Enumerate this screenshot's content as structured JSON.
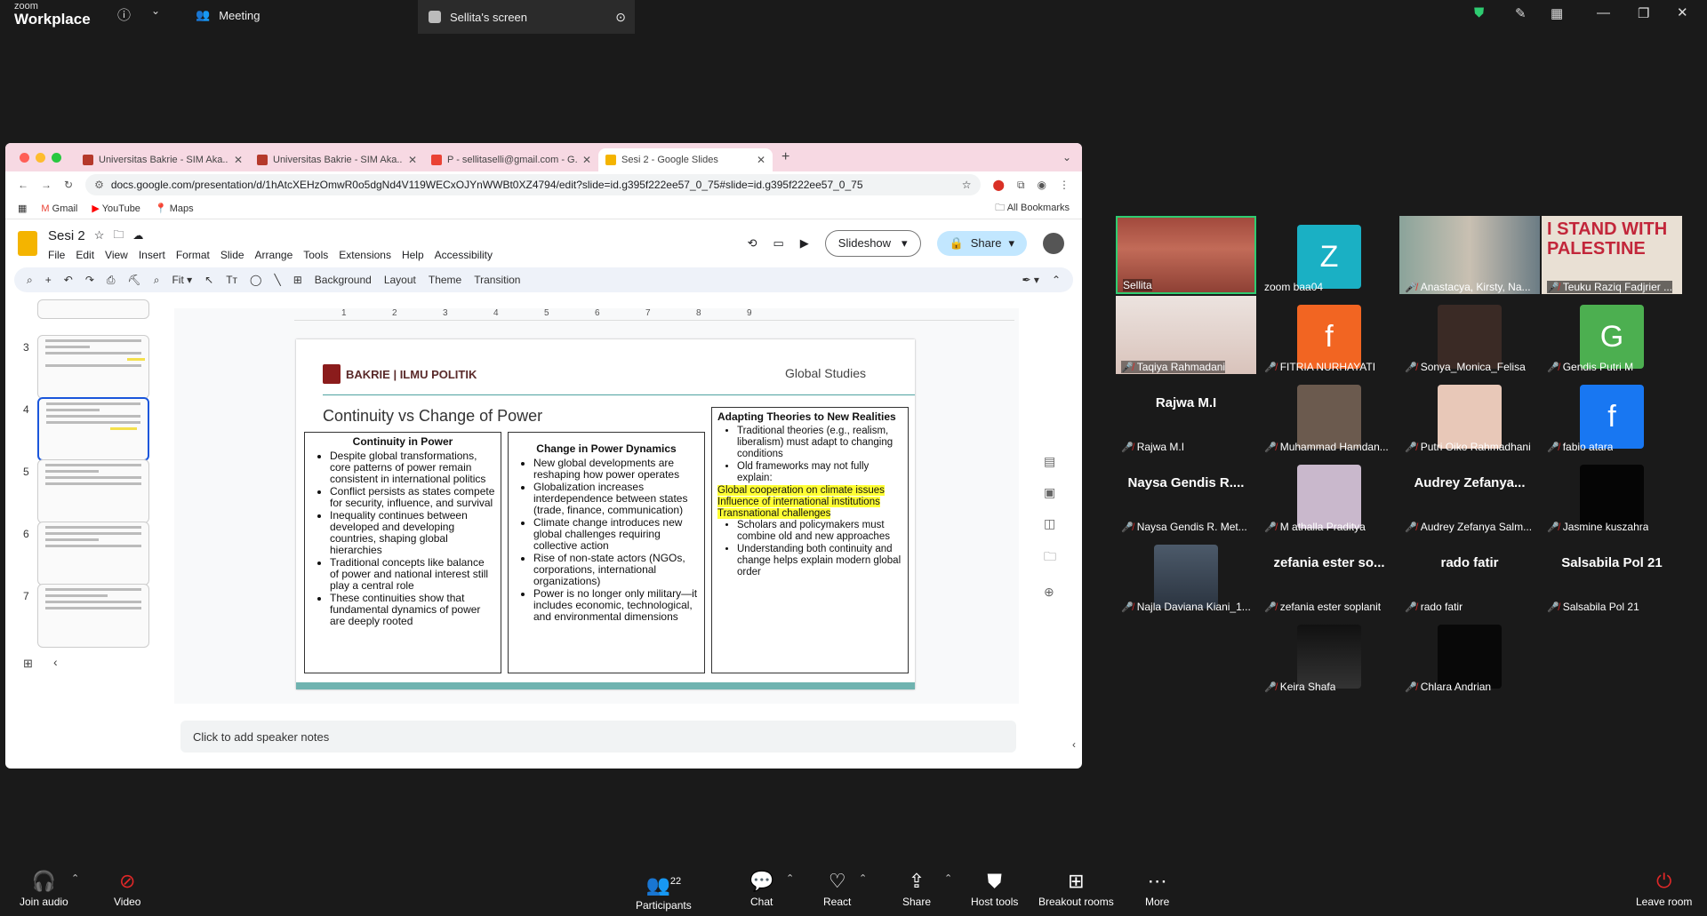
{
  "app": {
    "logo_top": "zoom",
    "logo_bottom": "Workplace"
  },
  "topbar": {
    "meeting_tab": "Meeting",
    "screen_tab": "Sellita's screen"
  },
  "browser": {
    "tabs": [
      {
        "label": "Universitas Bakrie - SIM Aka..."
      },
      {
        "label": "Universitas Bakrie - SIM Aka..."
      },
      {
        "label": "P - sellitaselli@gmail.com - G..."
      },
      {
        "label": "Sesi 2 - Google Slides"
      }
    ],
    "url": "docs.google.com/presentation/d/1hAtcXEHzOmwR0o5dgNd4V119WECxOJYnWWBt0XZ4794/edit?slide=id.g395f222ee57_0_75#slide=id.g395f222ee57_0_75",
    "bookmarks": [
      "Gmail",
      "YouTube",
      "Maps"
    ],
    "all_bookmarks": "All Bookmarks"
  },
  "slides": {
    "doc_title": "Sesi 2",
    "menus": [
      "File",
      "Edit",
      "View",
      "Insert",
      "Format",
      "Slide",
      "Arrange",
      "Tools",
      "Extensions",
      "Help",
      "Accessibility"
    ],
    "slideshow": "Slideshow",
    "share": "Share",
    "zoom": "Fit",
    "toolbar_labels": [
      "Background",
      "Layout",
      "Theme",
      "Transition"
    ],
    "thumb_numbers": [
      "3",
      "4",
      "5",
      "6",
      "7"
    ],
    "ruler_marks": [
      "1",
      "2",
      "3",
      "4",
      "5",
      "6",
      "7",
      "8",
      "9"
    ],
    "notes_placeholder": "Click to add speaker notes"
  },
  "slide": {
    "logo_text": "BAKRIE | ILMU POLITIK",
    "header_right": "Global Studies",
    "title": "Continuity vs Change of Power",
    "col1": {
      "heading": "Continuity in Power",
      "items": [
        "Despite global transformations, core patterns of power remain consistent in international politics",
        "Conflict persists as states compete for security, influence, and survival",
        "Inequality continues between developed and developing countries, shaping global hierarchies",
        "Traditional concepts like balance of power and national interest still play a central role",
        "These continuities show that fundamental dynamics of power are deeply rooted"
      ]
    },
    "col2": {
      "heading": "Change in Power Dynamics",
      "items": [
        "New global developments are reshaping how power operates",
        "Globalization increases interdependence between states (trade, finance, communication)",
        "Climate change introduces new global challenges requiring collective action",
        "Rise of non-state actors (NGOs, corporations, international organizations)",
        "Power is no longer only military—it includes economic, technological, and environmental dimensions"
      ]
    },
    "col3": {
      "heading": "Adapting Theories to New Realities",
      "items_a": [
        "Traditional theories (e.g., realism, liberalism) must adapt to changing conditions",
        "Old frameworks may not fully explain:"
      ],
      "highlights": [
        "Global cooperation on climate issues",
        "Influence of international institutions",
        "Transnational challenges"
      ],
      "items_b": [
        "Scholars and policymakers must combine old and new approaches",
        "Understanding both continuity and change helps explain modern global order"
      ]
    }
  },
  "gallery": {
    "tiles": [
      {
        "name": "Sellita",
        "avatar": "",
        "big": ""
      },
      {
        "name": "zoom baa04",
        "avatar": "Z",
        "big": ""
      },
      {
        "name": "Anastacya, Kirsty, Na...",
        "avatar": "",
        "big": ""
      },
      {
        "name": "Teuku Raziq Fadjrier ...",
        "avatar": "",
        "big": ""
      },
      {
        "name": "Taqiya Rahmadani",
        "avatar": "",
        "big": ""
      },
      {
        "name": "FITRIA NURHAYATI",
        "avatar": "f",
        "big": ""
      },
      {
        "name": "Sonya_Monica_Felisa",
        "avatar": "",
        "big": ""
      },
      {
        "name": "Gendis Putri M",
        "avatar": "G",
        "big": ""
      },
      {
        "name": "Rajwa M.I",
        "avatar": "",
        "big": "Rajwa M.I"
      },
      {
        "name": "Muhammad Hamdan...",
        "avatar": "",
        "big": ""
      },
      {
        "name": "Putri Oiko Rahmadhani",
        "avatar": "",
        "big": ""
      },
      {
        "name": "fabio atara",
        "avatar": "f",
        "big": ""
      },
      {
        "name": "Naysa Gendis R. Met...",
        "avatar": "",
        "big": "Naysa Gendis R...."
      },
      {
        "name": "M athalla Praditya",
        "avatar": "",
        "big": ""
      },
      {
        "name": "Audrey Zefanya Salm...",
        "avatar": "",
        "big": "Audrey  Zefanya..."
      },
      {
        "name": "Jasmine kuszahra",
        "avatar": "",
        "big": ""
      },
      {
        "name": "Najla Daviana Kiani_1...",
        "avatar": "",
        "big": ""
      },
      {
        "name": "zefania ester soplanit",
        "avatar": "",
        "big": "zefania ester so..."
      },
      {
        "name": "rado fatir",
        "avatar": "",
        "big": "rado fatir"
      },
      {
        "name": "Salsabila Pol 21",
        "avatar": "",
        "big": "Salsabila Pol 21"
      },
      {
        "name": "Keira Shafa",
        "avatar": "",
        "big": ""
      },
      {
        "name": "Chlara Andrian",
        "avatar": "",
        "big": ""
      }
    ],
    "banner_text": "I STAND WITH PALESTINE",
    "colors": {
      "z": "#1ab0c4",
      "f": "#f26522",
      "g": "#4caf50",
      "fb": "#1877f2"
    }
  },
  "bottom": {
    "join_audio": "Join audio",
    "video": "Video",
    "participants": "Participants",
    "participants_count": "22",
    "chat": "Chat",
    "react": "React",
    "share": "Share",
    "host_tools": "Host tools",
    "breakout": "Breakout rooms",
    "more": "More",
    "leave": "Leave room"
  }
}
